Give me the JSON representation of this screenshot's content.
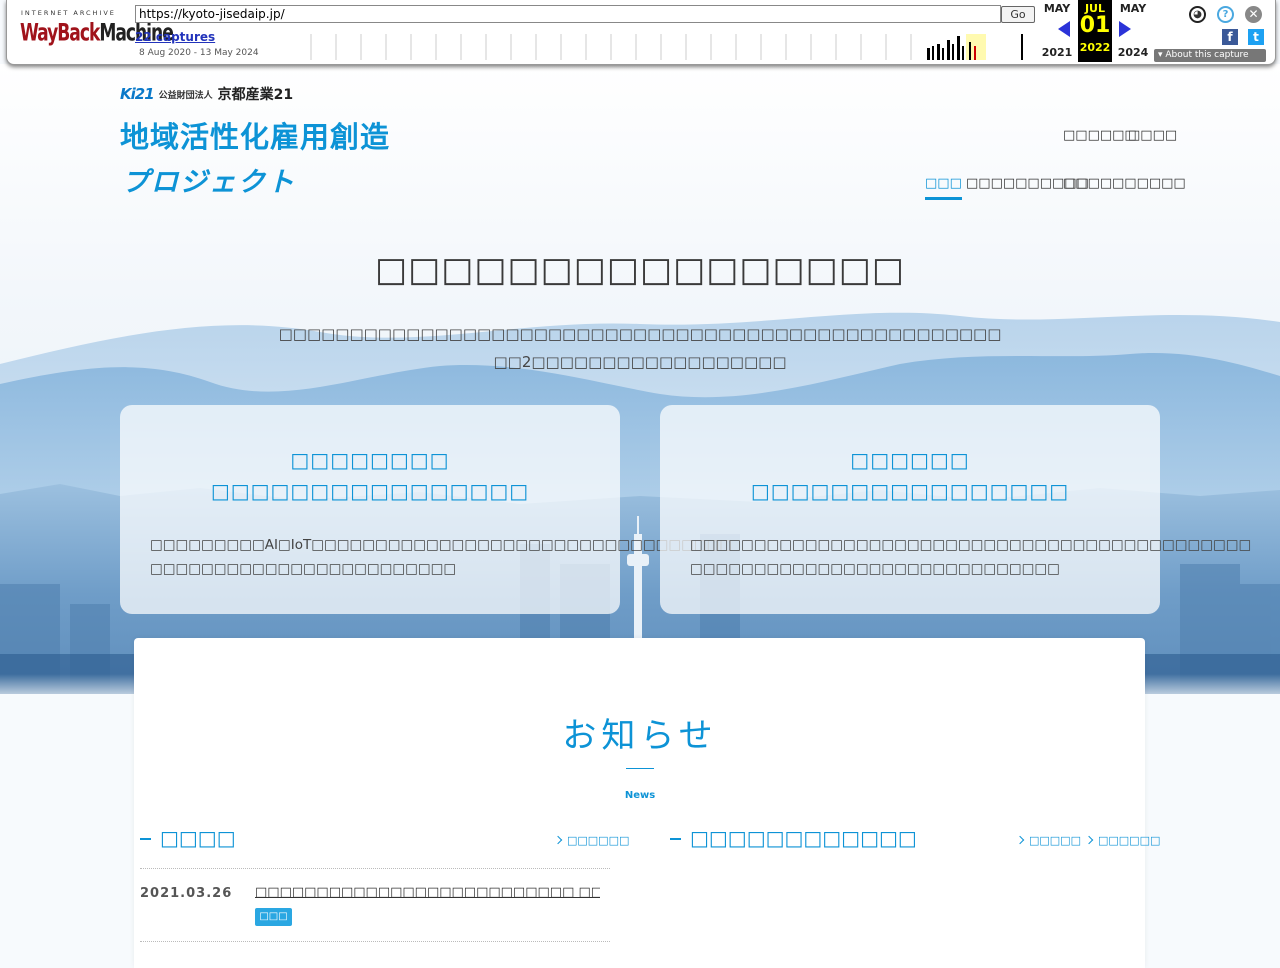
{
  "wayback": {
    "ia_label": "INTERNET ARCHIVE",
    "logo_part1": "WayBack",
    "logo_part2": "Machine",
    "url": "https://kyoto-jisedaip.jp/",
    "go_label": "Go",
    "captures": "22 captures",
    "date_range": "8 Aug 2020 - 13 May 2024",
    "prev_month": "MAY",
    "prev_year": "2021",
    "cur_month": "JUL",
    "cur_day": "01",
    "cur_year": "2022",
    "next_month": "MAY",
    "next_year": "2024",
    "about": "About this capture",
    "facebook_glyph": "f",
    "twitter_glyph": "t",
    "help_glyph": "?",
    "close_glyph": "✕",
    "user_glyph": "◕"
  },
  "header": {
    "org_logo_mark": "Ki21",
    "org_small": "公益財団法人",
    "org_name": "京都産業21",
    "title_line1": "地域活性化雇用創造",
    "title_line2": "プロジェクト",
    "util_links": [
      "□□□□□□",
      "□□□□"
    ],
    "nav": [
      "□□□",
      "□□□□□□□□□□",
      "□□□□",
      "□□□□□□"
    ]
  },
  "hero": {
    "title": "□□□□□□□□□□□□□□□□",
    "lead_line1": "□□□□□□□□□□□□□□□□□□□□□□□□□□□□□□□□□□□□□□□□□□□□□□□□□□□",
    "lead_line2": "□□2□□□□□□□□□□□□□□□□□□"
  },
  "cards": [
    {
      "title_line1": "□□□□□□□□",
      "title_line2": "□□□□□□□□□□□□□□□□",
      "desc_line1": "□□□□□□□□□AI□IoT□□□□□□□□□□□□□□□□□□□□□□□□□□□□□□□□□",
      "desc_line2": "□□□□□□□□□□□□□□□□□□□□□□□□"
    },
    {
      "title_line1": "□□□□□□",
      "title_line2": "□□□□□□□□□□□□□□□□",
      "desc_line1": "□□□□□□□□□□□□□□□□□□□□□□□□□□□□□□□□□□□□□□□□□□□□",
      "desc_line2": "□□□□□□□□□□□□□□□□□□□□□□□□□□□□□"
    }
  ],
  "news": {
    "heading": "お知らせ",
    "subheading": "News",
    "left_title": "□□□□",
    "left_link": "□□□□□□",
    "right_title": "□□□□□□□□□□□□",
    "right_link1": "□□□□□",
    "right_link2": "□□□□□□",
    "items": [
      {
        "date": "2021.03.26",
        "title": "□□□□□□□□□□□□□□□□□□□□□□□□□□ □□□□□□□□□□□□□□□□□□□",
        "badge": "□□□"
      }
    ]
  },
  "colors": {
    "accent": "#0d93d6",
    "badge": "#2aa7e2",
    "wayback_red": "#a0131b",
    "wayback_nav_arrow": "#2b33d8"
  }
}
